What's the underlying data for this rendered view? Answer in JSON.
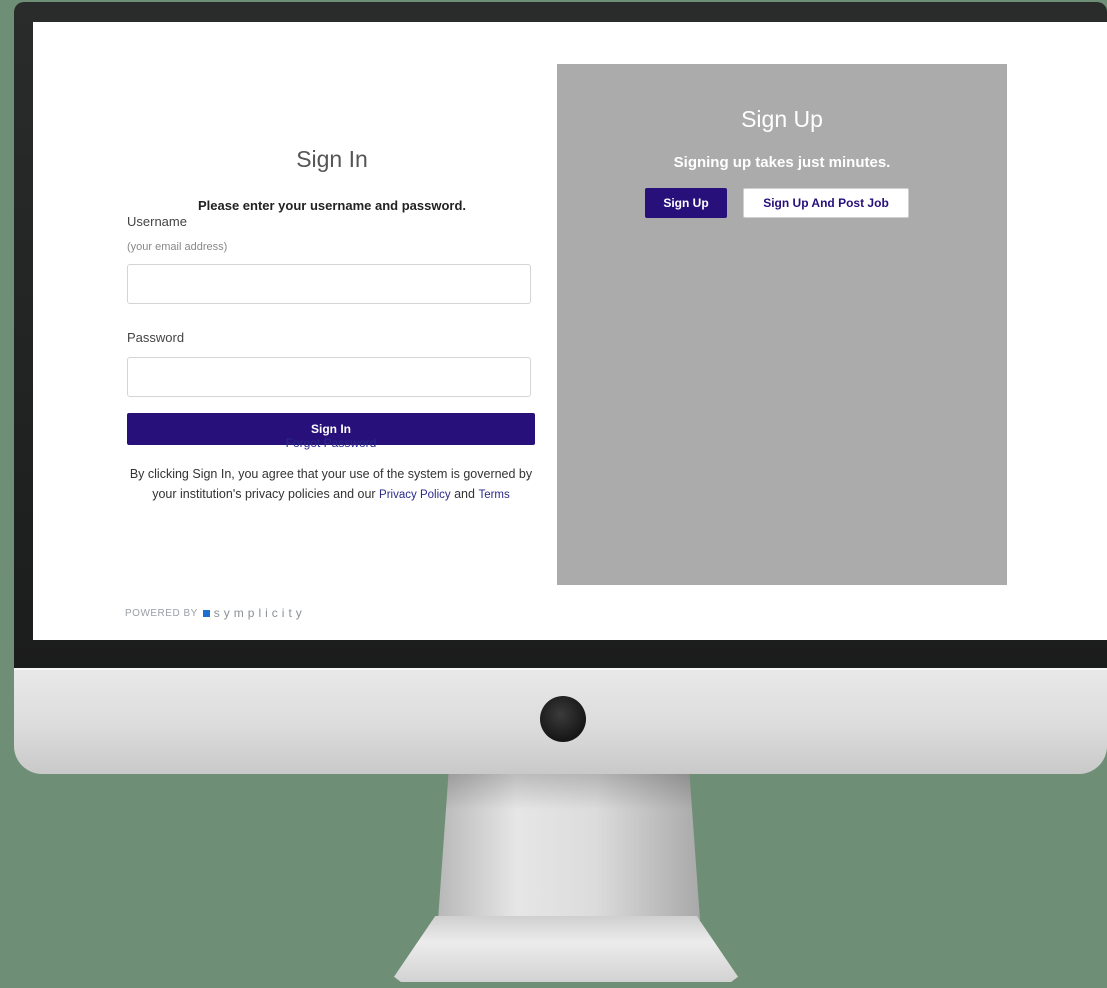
{
  "signin": {
    "title": "Sign In",
    "subtitle": "Please enter your username and password.",
    "username_label": "Username",
    "username_hint": "(your email address)",
    "username_value": "",
    "password_label": "Password",
    "password_value": "",
    "submit_label": "Sign In",
    "forgot_label": "Forgot Password",
    "legal_prefix": "By clicking Sign In, you agree that your use of the system is governed by your institution's privacy policies and our ",
    "privacy_link": "Privacy Policy",
    "legal_and": " and ",
    "terms_link": "Terms"
  },
  "signup": {
    "title": "Sign Up",
    "subtitle": "Signing up takes just minutes.",
    "signup_label": "Sign Up",
    "signup_post_label": "Sign Up And Post Job"
  },
  "footer": {
    "powered_by": "POWERED BY",
    "brand": "symplicity"
  },
  "colors": {
    "accent": "#27107a",
    "signup_bg": "#ababab",
    "background": "#6e8e76"
  }
}
